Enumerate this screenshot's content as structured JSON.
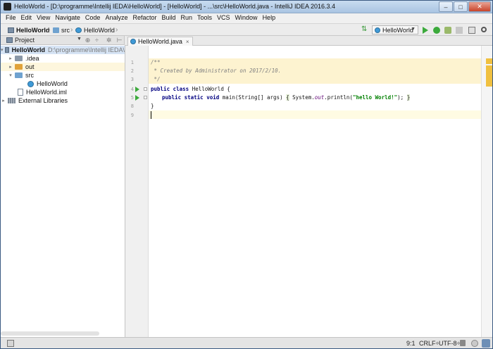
{
  "window": {
    "title": "HelloWorld - [D:\\programme\\Intellij IEDA\\HelloWorld] - [HelloWorld] - ...\\src\\HelloWorld.java - IntelliJ IDEA 2016.3.4",
    "min_label": "–",
    "max_label": "□",
    "close_label": "✕"
  },
  "menu": [
    "File",
    "Edit",
    "View",
    "Navigate",
    "Code",
    "Analyze",
    "Refactor",
    "Build",
    "Run",
    "Tools",
    "VCS",
    "Window",
    "Help"
  ],
  "navbar": {
    "crumbs": [
      "HelloWorld",
      "src",
      "HelloWorld"
    ],
    "run_config": "HelloWorld",
    "separator": "›"
  },
  "project_pane": {
    "title": "Project",
    "header_icons": [
      "⊕",
      "÷",
      "✲",
      "⊢"
    ],
    "tree": [
      {
        "label": "HelloWorld",
        "path": "D:\\programme\\Intellij IEDA\\",
        "arrow": "▾",
        "icon": "project"
      },
      {
        "label": ".idea",
        "arrow": "▸",
        "icon": "folder-grey"
      },
      {
        "label": "out",
        "arrow": "▸",
        "icon": "folder-orange"
      },
      {
        "label": "src",
        "arrow": "▾",
        "icon": "folder-blue"
      },
      {
        "label": "HelloWorld",
        "arrow": "",
        "icon": "class"
      },
      {
        "label": "HelloWorld.iml",
        "arrow": "",
        "icon": "iml"
      },
      {
        "label": "External Libraries",
        "arrow": "▸",
        "icon": "library"
      }
    ]
  },
  "editor": {
    "tab_label": "HelloWorld.java",
    "tab_close": "×",
    "line_numbers": [
      "1",
      "2",
      "3",
      "4",
      "5",
      "8",
      "9"
    ],
    "lines": {
      "l1": "/**",
      "l2": " * Created by Administrator on 2017/2/10.",
      "l3": " */",
      "l4_kw": "public class",
      "l4_rest": " HelloWorld {",
      "l5_kw": "public static void",
      "l5_mid": " main(String[] args) ",
      "l5_brace_open": "{",
      "l5_sys": " System.",
      "l5_field": "out",
      "l5_call": ".println(",
      "l5_str": "\"hello World!\"",
      "l5_end": "); ",
      "l5_brace_close": "}",
      "l8": "}"
    }
  },
  "status": {
    "position": "9:1",
    "line_sep": "CRLF÷",
    "encoding": "UTF-8÷"
  },
  "colors": {
    "keyword": "#000080",
    "string": "#008000",
    "comment": "#808080",
    "run_green": "#3caa3c"
  }
}
